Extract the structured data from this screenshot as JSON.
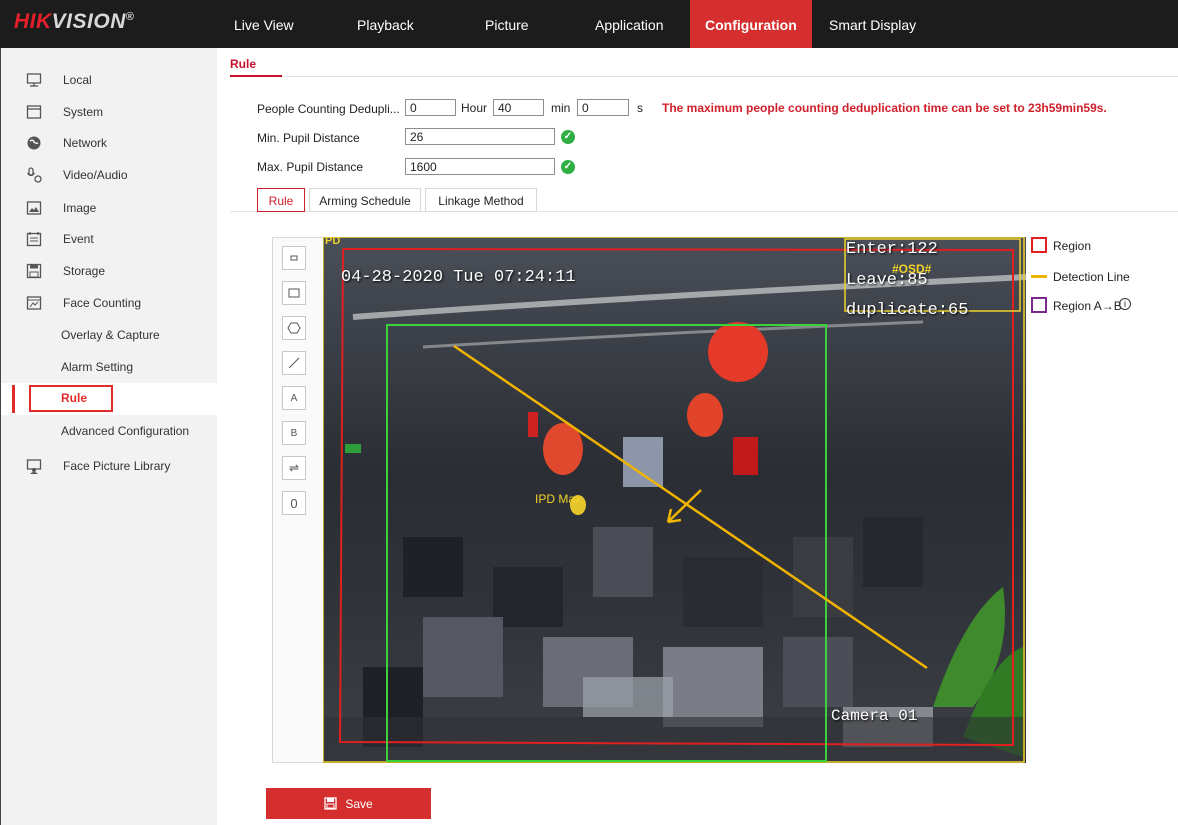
{
  "brand": {
    "logo_red": "HIK",
    "logo_white": "VISION",
    "registered": "®"
  },
  "nav": {
    "items": [
      "Live View",
      "Playback",
      "Picture",
      "Application",
      "Configuration",
      "Smart Display"
    ],
    "active": "Configuration"
  },
  "sidebar": {
    "items": [
      "Local",
      "System",
      "Network",
      "Video/Audio",
      "Image",
      "Event",
      "Storage",
      "Face Counting"
    ],
    "sub_items": [
      "Overlay & Capture",
      "Alarm Setting",
      "Rule",
      "Advanced Configuration"
    ],
    "last_item": "Face Picture Library",
    "active_sub": "Rule"
  },
  "main": {
    "tab": "Rule",
    "dedup_label": "People Counting Dedupli...",
    "dedup_hour": "0",
    "hour_unit": "Hour",
    "dedup_min": "40",
    "min_unit": "min",
    "dedup_sec": "0",
    "sec_unit": "s",
    "dedup_note": "The maximum people counting deduplication time can be set to 23h59min59s.",
    "min_pupil_label": "Min. Pupil Distance",
    "min_pupil_value": "26",
    "max_pupil_label": "Max. Pupil Distance",
    "max_pupil_value": "1600",
    "subtabs": [
      "Rule",
      "Arming Schedule",
      "Linkage Method"
    ],
    "active_subtab": "Rule"
  },
  "video": {
    "timestamp": "04-28-2020 Tue 07:24:11",
    "enter": "Enter:122",
    "leave": "Leave:85",
    "duplicate": "duplicate:65",
    "osd_tag": "#OSD#",
    "ipd_label": "IPD Max",
    "camera_label": "Camera 01",
    "corner_tag": "PD"
  },
  "toolbar": {
    "icons": [
      "small-rect-icon",
      "rect-icon",
      "hexagon-icon",
      "line-icon",
      "region-a-icon",
      "region-b-icon",
      "swap-direction-icon",
      "zero-counter-icon"
    ],
    "region_a": "A",
    "region_b": "B",
    "zero": "0"
  },
  "legend": {
    "region": "Region",
    "detection_line": "Detection Line",
    "region_ab": "Region A→B",
    "region_color": "#e02020",
    "line_color": "#f0b400",
    "region_ab_color": "#7a2a8a"
  },
  "save": {
    "label": "Save"
  },
  "colors": {
    "accent": "#d42e2e",
    "ok": "#2fae44"
  }
}
